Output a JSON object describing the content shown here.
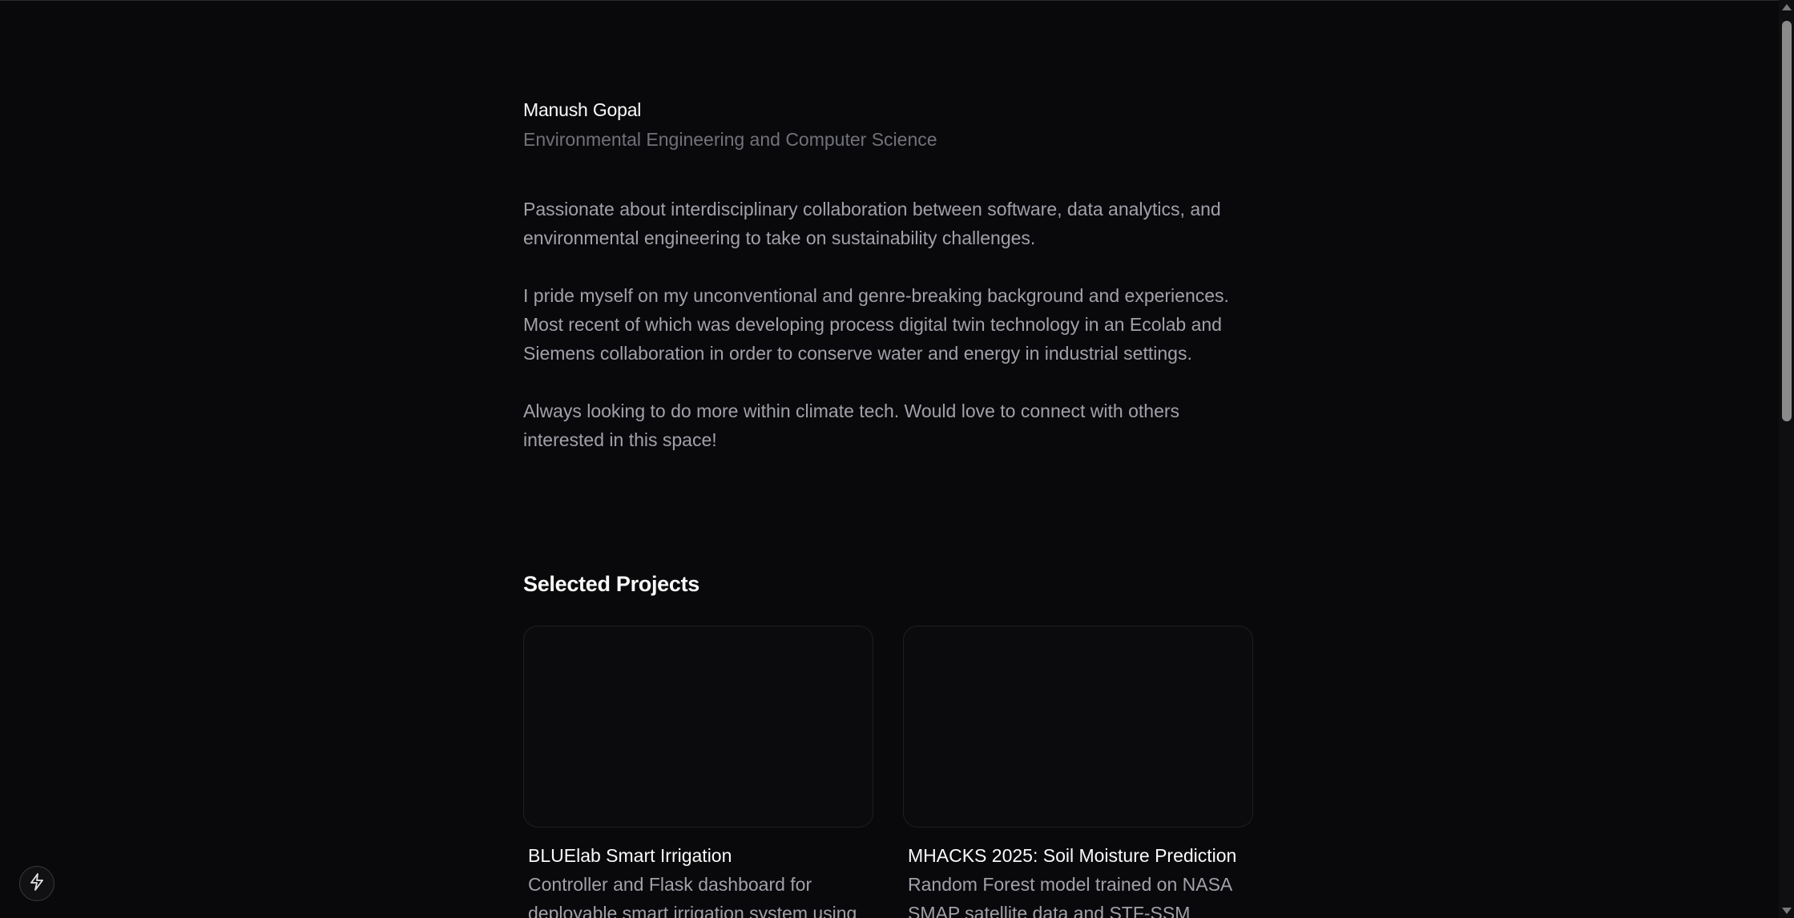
{
  "header": {
    "name": "Manush Gopal",
    "subtitle": "Environmental Engineering and Computer Science"
  },
  "bio": {
    "paragraphs": [
      "Passionate about interdisciplinary collaboration between software, data analytics, and environmental engineering to take on sustainability challenges.",
      "I pride myself on my unconventional and genre-breaking background and experiences. Most recent of which was developing process digital twin technology in an Ecolab and Siemens collaboration in order to conserve water and energy in industrial settings.",
      "Always looking to do more within climate tech. Would love to connect with others interested in this space!"
    ]
  },
  "projects": {
    "heading": "Selected Projects",
    "items": [
      {
        "title": "BLUElab Smart Irrigation",
        "description": "Controller and Flask dashboard for deployable smart irrigation system using"
      },
      {
        "title": "MHACKS 2025: Soil Moisture Prediction",
        "description": "Random Forest model trained on NASA SMAP satellite data and STF-SSM"
      }
    ]
  },
  "badge": {
    "icon": "lightning-bolt-icon"
  },
  "colors": {
    "background": "#09090b",
    "text_primary": "#fafafa",
    "text_secondary": "#a1a1aa",
    "text_muted": "#71717a"
  }
}
